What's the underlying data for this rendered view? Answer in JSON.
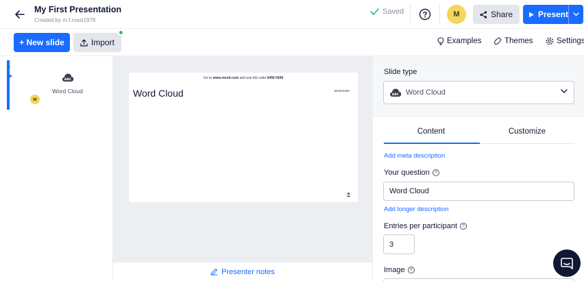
{
  "header": {
    "title": "My First Presentation",
    "subtitle": "Created by m.f.rossi1978",
    "saved_label": "Saved",
    "avatar_initial": "M",
    "share_label": "Share",
    "present_label": "Present"
  },
  "toolbar": {
    "new_slide_label": "+ New slide",
    "import_label": "Import",
    "examples_label": "Examples",
    "themes_label": "Themes",
    "settings_label": "Settings"
  },
  "slides": [
    {
      "number": "1",
      "label": "Word Cloud",
      "avatar_initial": "M"
    }
  ],
  "canvas": {
    "code_prefix": "Go to",
    "code_site": "www.menti.com",
    "code_middle": "and use the code",
    "code_value": "6456 0949",
    "brand": "Mentimeter",
    "slide_title": "Word Cloud",
    "presenter_notes_label": "Presenter notes"
  },
  "panel": {
    "slide_type_label": "Slide type",
    "slide_type_value": "Word Cloud",
    "tabs": [
      "Content",
      "Customize"
    ],
    "add_meta_label": "Add meta description",
    "question_label": "Your question",
    "question_value": "Word Cloud",
    "add_longer_label": "Add longer description",
    "entries_label": "Entries per participant",
    "entries_value": "3",
    "image_label": "Image"
  },
  "colors": {
    "accent": "#196cff",
    "avatar": "#f6d65a",
    "saved_check": "#23c46b"
  }
}
